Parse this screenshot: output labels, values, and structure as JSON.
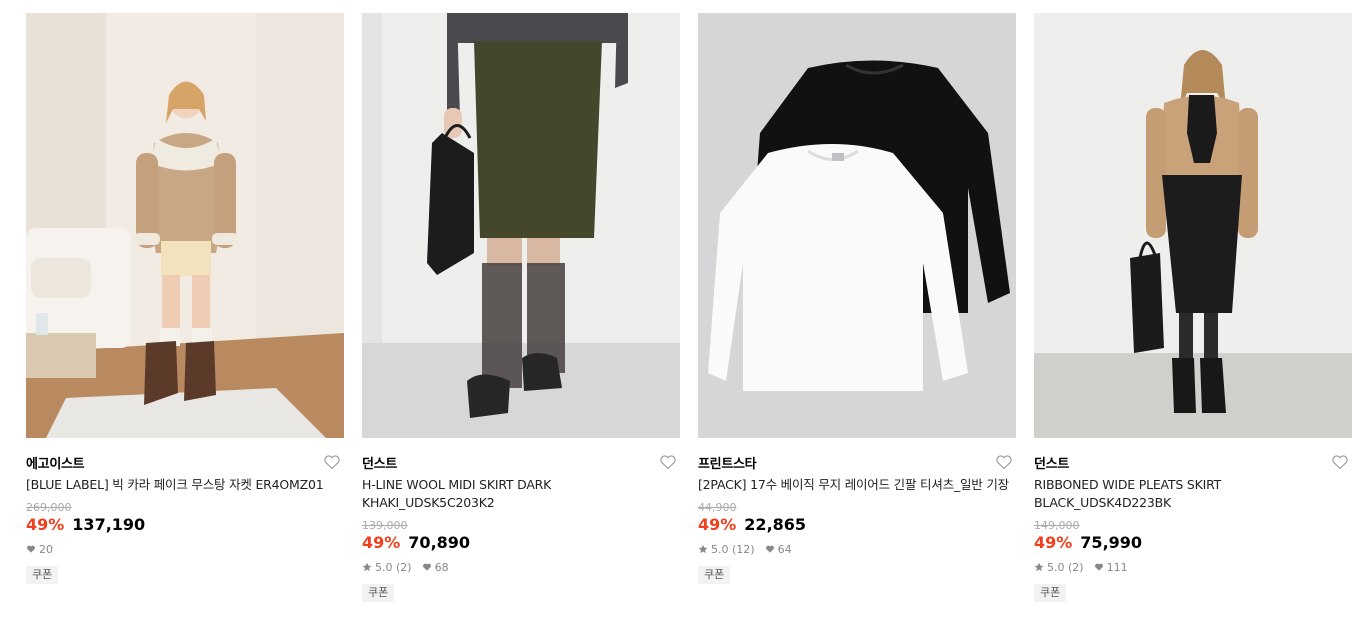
{
  "products": [
    {
      "brand": "에고이스트",
      "title": "[BLUE LABEL] 빅 카라 페이크 무스탕 자켓 ER4OMZ01",
      "original_price": "269,000",
      "discount": "49%",
      "price": "137,190",
      "rating": "",
      "likes": "20",
      "coupon": "쿠폰",
      "image": "model-shearling-jacket"
    },
    {
      "brand": "던스트",
      "title": "H-LINE WOOL MIDI SKIRT DARK KHAKI_UDSK5C203K2",
      "original_price": "139,000",
      "discount": "49%",
      "price": "70,890",
      "rating": "5.0 (2)",
      "likes": "68",
      "coupon": "쿠폰",
      "image": "wool-midi-skirt"
    },
    {
      "brand": "프린트스타",
      "title": "[2PACK] 17수 베이직 무지 레이어드 긴팔 티셔츠_일반 기장",
      "original_price": "44,900",
      "discount": "49%",
      "price": "22,865",
      "rating": "5.0 (12)",
      "likes": "64",
      "coupon": "쿠폰",
      "image": "long-sleeve-tshirts"
    },
    {
      "brand": "던스트",
      "title": "RIBBONED WIDE PLEATS SKIRT BLACK_UDSK4D223BK",
      "original_price": "149,000",
      "discount": "49%",
      "price": "75,990",
      "rating": "5.0 (2)",
      "likes": "111",
      "coupon": "쿠폰",
      "image": "model-pleats-skirt"
    }
  ],
  "colors": {
    "discount": "#ef3e1b",
    "original_price": "#aaaaaa",
    "meta": "#888888",
    "coupon_bg": "#f2f2f2"
  }
}
